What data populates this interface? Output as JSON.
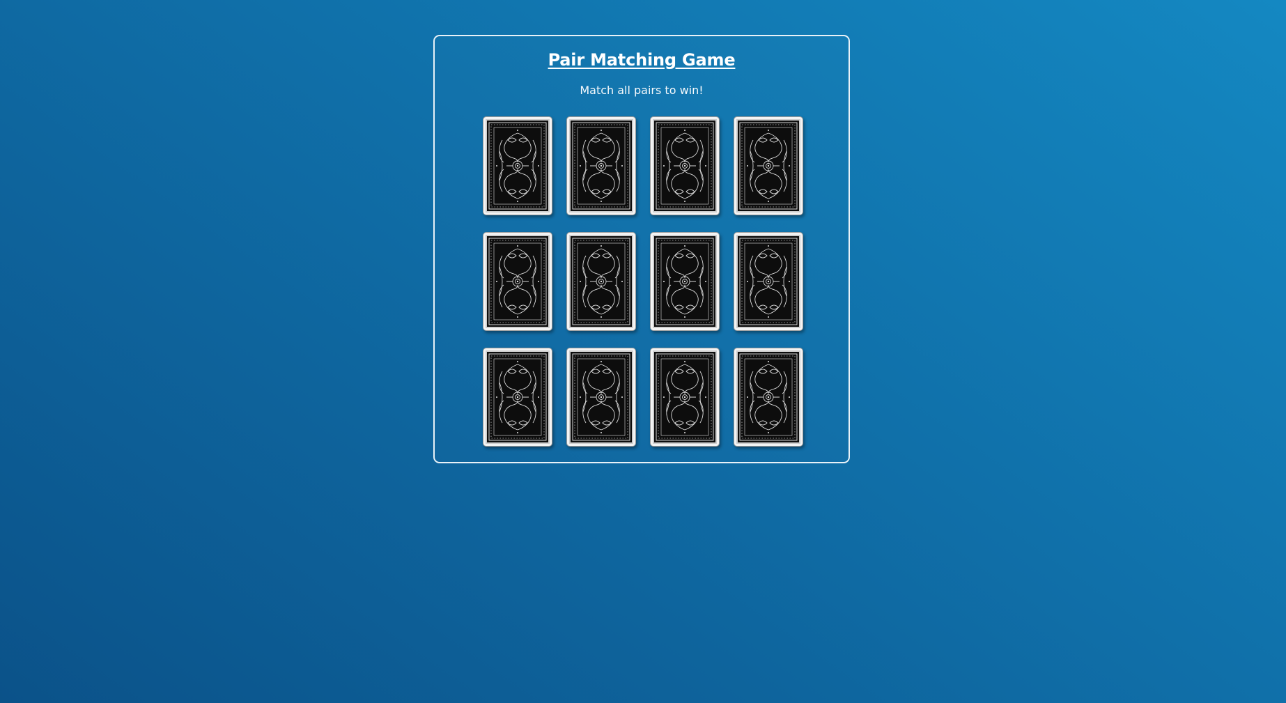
{
  "game": {
    "title": "Pair Matching Game",
    "subtitle": "Match all pairs to win!",
    "rows": 3,
    "columns": 4,
    "cards": [
      {
        "state": "face-down"
      },
      {
        "state": "face-down"
      },
      {
        "state": "face-down"
      },
      {
        "state": "face-down"
      },
      {
        "state": "face-down"
      },
      {
        "state": "face-down"
      },
      {
        "state": "face-down"
      },
      {
        "state": "face-down"
      },
      {
        "state": "face-down"
      },
      {
        "state": "face-down"
      },
      {
        "state": "face-down"
      },
      {
        "state": "face-down"
      }
    ]
  },
  "colors": {
    "background": "#0f6aa3",
    "panel_border": "#e9f2f8",
    "card_back": "#111111",
    "card_frame": "#f4f4f4"
  },
  "icons": {
    "card_back": "ornate-card-back-icon"
  }
}
